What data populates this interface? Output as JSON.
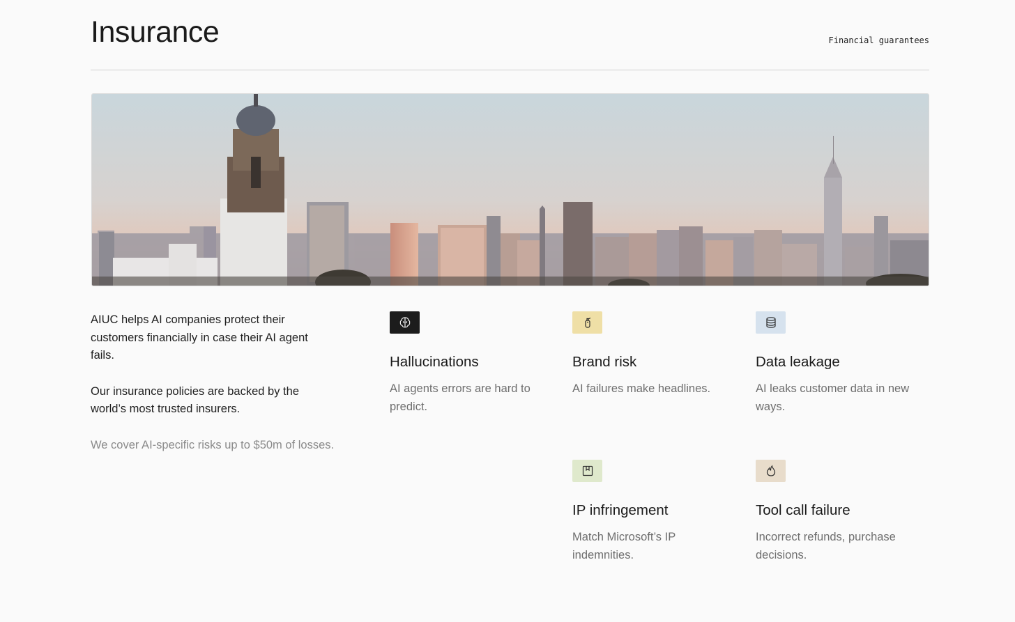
{
  "header": {
    "title": "Insurance",
    "tag": "Financial guarantees"
  },
  "hero": {
    "image": "city-skyline-photo"
  },
  "intro": {
    "paragraph1": "AIUC helps AI companies protect their customers financially in case their AI agent fails.",
    "paragraph2": "Our insurance policies are backed by the world’s most trusted insurers.",
    "paragraph3": "We cover AI-specific risks up to $50m of losses."
  },
  "risks": [
    {
      "title": "Hallucinations",
      "description": "AI agents errors are hard to predict.",
      "icon": "brain-icon",
      "color": "#1c1c1c"
    },
    {
      "title": "Brand risk",
      "description": "AI failures make headlines.",
      "icon": "fire-extinguisher-icon",
      "color": "#efdfa6"
    },
    {
      "title": "Data leakage",
      "description": "AI leaks customer data in new ways.",
      "icon": "database-icon",
      "color": "#d6e2ee"
    },
    {
      "title": "IP infringement",
      "description": "Match Microsoft’s IP indemnities.",
      "icon": "bookmark-box-icon",
      "color": "#dfe9cc"
    },
    {
      "title": "Tool call failure",
      "description": "Incorrect refunds, purchase decisions.",
      "icon": "flame-icon",
      "color": "#e8dccb"
    }
  ]
}
